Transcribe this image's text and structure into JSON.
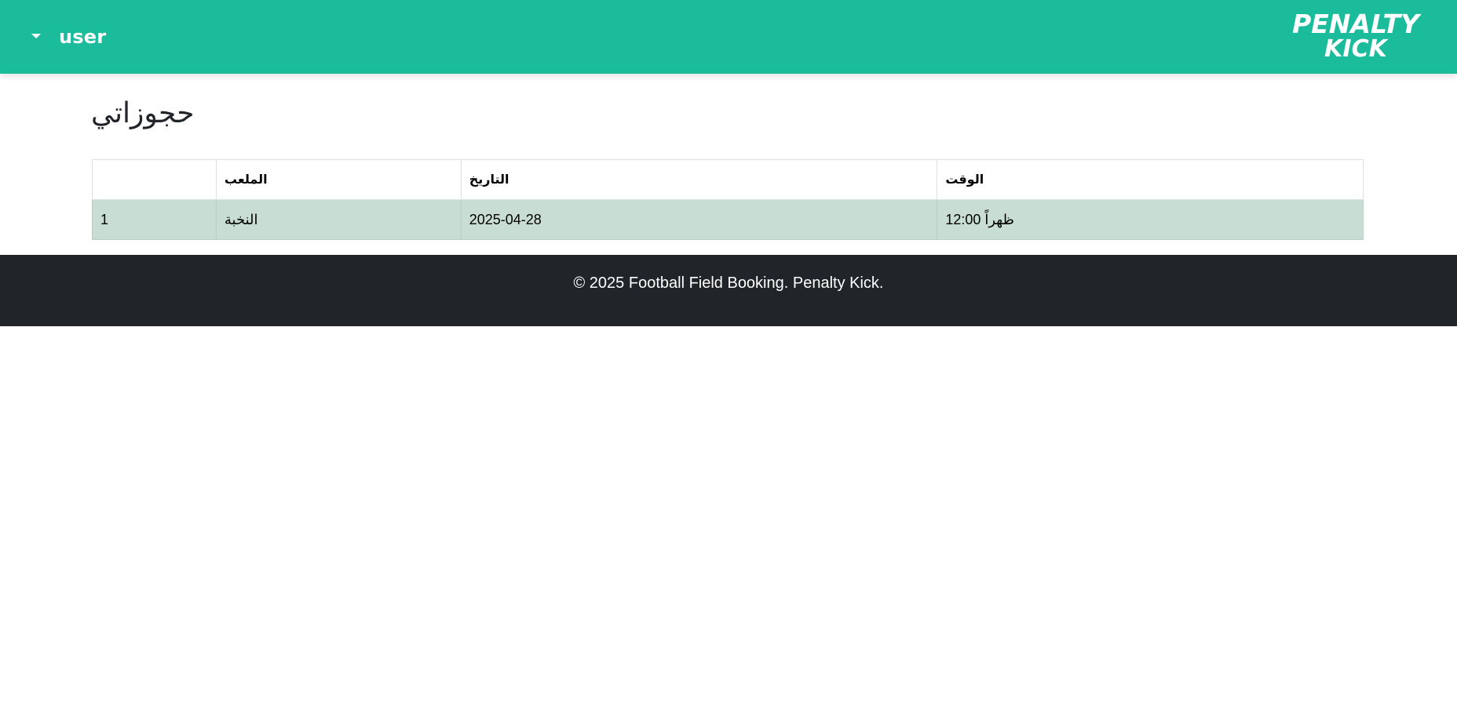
{
  "colors": {
    "header": "#1abc9c",
    "footer": "#212529",
    "row": "#c8ddd3"
  },
  "header": {
    "user_label": "user",
    "caret_icon": "caret-down-icon",
    "logo": {
      "line1": "PENALTY",
      "line2": "KICK"
    }
  },
  "page": {
    "title": "حجوزاتي"
  },
  "table": {
    "columns": [
      "",
      "الملعب",
      "التاريخ",
      "الوقت"
    ],
    "rows": [
      {
        "index": "1",
        "field": "النخبة",
        "date": "2025-04-28",
        "time": "12:00 ظهراً"
      }
    ]
  },
  "footer": {
    "text": "© 2025 Football Field Booking. Penalty Kick."
  }
}
